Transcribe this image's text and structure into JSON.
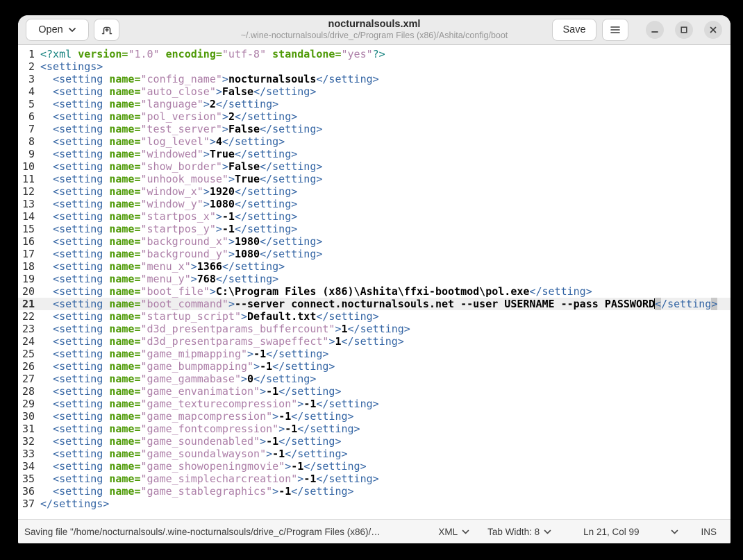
{
  "window": {
    "title": "nocturnalsouls.xml",
    "subtitle": "~/.wine-nocturnalsouls/drive_c/Program Files (x86)/Ashita/config/boot"
  },
  "header": {
    "open_label": "Open",
    "save_label": "Save"
  },
  "status_bar": {
    "message": "Saving file \"/home/nocturnalsouls/.wine-nocturnalsouls/drive_c/Program Files (x86)/…",
    "language": "XML",
    "tab_width": "Tab Width: 8",
    "cursor_position": "Ln 21, Col 99",
    "insert_mode": "INS"
  },
  "colors": {
    "tag": "#3465a4",
    "processing_instruction": "#12807d",
    "attribute": "#4e9a06",
    "string": "#ad7fa8",
    "value_text": "#000000",
    "current_line_bg": "#efefef",
    "bracket_match_bg": "#c9c9c9",
    "headerbar_bg": "#ebebeb"
  },
  "editor": {
    "cursor": {
      "line": 21,
      "col": 99
    },
    "lines": [
      {
        "n": 1,
        "tokens": [
          [
            "pi",
            "<?xml "
          ],
          [
            "attr",
            "version="
          ],
          [
            "str",
            "\"1.0\""
          ],
          [
            "plain",
            " "
          ],
          [
            "attr",
            "encoding="
          ],
          [
            "str",
            "\"utf-8\""
          ],
          [
            "plain",
            " "
          ],
          [
            "attr",
            "standalone="
          ],
          [
            "str",
            "\"yes\""
          ],
          [
            "pi",
            "?>"
          ]
        ]
      },
      {
        "n": 2,
        "tokens": [
          [
            "tag",
            "<settings>"
          ]
        ]
      },
      {
        "n": 3,
        "name": "config_name",
        "value": "nocturnalsouls"
      },
      {
        "n": 4,
        "name": "auto_close",
        "value": "False"
      },
      {
        "n": 5,
        "name": "language",
        "value": "2"
      },
      {
        "n": 6,
        "name": "pol_version",
        "value": "2"
      },
      {
        "n": 7,
        "name": "test_server",
        "value": "False"
      },
      {
        "n": 8,
        "name": "log_level",
        "value": "4"
      },
      {
        "n": 9,
        "name": "windowed",
        "value": "True"
      },
      {
        "n": 10,
        "name": "show_border",
        "value": "False"
      },
      {
        "n": 11,
        "name": "unhook_mouse",
        "value": "True"
      },
      {
        "n": 12,
        "name": "window_x",
        "value": "1920"
      },
      {
        "n": 13,
        "name": "window_y",
        "value": "1080"
      },
      {
        "n": 14,
        "name": "startpos_x",
        "value": "-1"
      },
      {
        "n": 15,
        "name": "startpos_y",
        "value": "-1"
      },
      {
        "n": 16,
        "name": "background_x",
        "value": "1980"
      },
      {
        "n": 17,
        "name": "background_y",
        "value": "1080"
      },
      {
        "n": 18,
        "name": "menu_x",
        "value": "1366"
      },
      {
        "n": 19,
        "name": "menu_y",
        "value": "768"
      },
      {
        "n": 20,
        "name": "boot_file",
        "value": "C:\\Program Files (x86)\\Ashita\\ffxi-bootmod\\pol.exe"
      },
      {
        "n": 21,
        "name": "boot_command",
        "value": "--server connect.nocturnalsouls.net --user USERNAME --pass PASSWORD",
        "caret": true
      },
      {
        "n": 22,
        "name": "startup_script",
        "value": "Default.txt"
      },
      {
        "n": 23,
        "name": "d3d_presentparams_buffercount",
        "value": "1"
      },
      {
        "n": 24,
        "name": "d3d_presentparams_swapeffect",
        "value": "1"
      },
      {
        "n": 25,
        "name": "game_mipmapping",
        "value": "-1"
      },
      {
        "n": 26,
        "name": "game_bumpmapping",
        "value": "-1"
      },
      {
        "n": 27,
        "name": "game_gammabase",
        "value": "0"
      },
      {
        "n": 28,
        "name": "game_envanimation",
        "value": "-1"
      },
      {
        "n": 29,
        "name": "game_texturecompression",
        "value": "-1"
      },
      {
        "n": 30,
        "name": "game_mapcompression",
        "value": "-1"
      },
      {
        "n": 31,
        "name": "game_fontcompression",
        "value": "-1"
      },
      {
        "n": 32,
        "name": "game_soundenabled",
        "value": "-1"
      },
      {
        "n": 33,
        "name": "game_soundalwayson",
        "value": "-1"
      },
      {
        "n": 34,
        "name": "game_showopeningmovie",
        "value": "-1"
      },
      {
        "n": 35,
        "name": "game_simplecharcreation",
        "value": "-1"
      },
      {
        "n": 36,
        "name": "game_stablegraphics",
        "value": "-1"
      },
      {
        "n": 37,
        "tokens": [
          [
            "tag",
            "</settings>"
          ]
        ]
      }
    ]
  }
}
